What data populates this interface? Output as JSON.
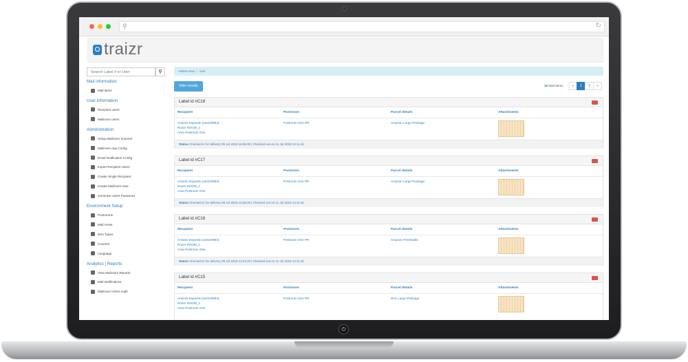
{
  "browser": {
    "url": ""
  },
  "app": {
    "logo_text": "traizr"
  },
  "search": {
    "placeholder": "Search Label # or User"
  },
  "sidebar": {
    "sections": [
      {
        "title": "Mail information",
        "items": [
          {
            "label": "Mail items",
            "icon": "home-icon"
          }
        ]
      },
      {
        "title": "User information",
        "items": [
          {
            "label": "Recipient users",
            "icon": "users-icon"
          },
          {
            "label": "Mailroom users",
            "icon": "user-icon"
          }
        ]
      },
      {
        "title": "Administration",
        "items": [
          {
            "label": "Setup Mailroom Scanner",
            "icon": "wrench-icon"
          },
          {
            "label": "Mailroom App Config",
            "icon": "phone-icon"
          },
          {
            "label": "Email Notification Config",
            "icon": "envelope-icon"
          },
          {
            "label": "Import Recipient Users",
            "icon": "import-icon"
          },
          {
            "label": "Create Single Recipient",
            "icon": "user-icon"
          },
          {
            "label": "Create Mailroom User",
            "icon": "user-icon"
          },
          {
            "label": "Generate Users Password",
            "icon": "lock-icon"
          }
        ]
      },
      {
        "title": "Environment Setup",
        "items": [
          {
            "label": "Postrooms",
            "icon": "building-icon"
          },
          {
            "label": "Mail Areas",
            "icon": "map-icon"
          },
          {
            "label": "Item Types",
            "icon": "list-icon"
          },
          {
            "label": "Couriers",
            "icon": "truck-icon"
          },
          {
            "label": "Language",
            "icon": "globe-icon"
          }
        ]
      },
      {
        "title": "Analytics | Reports",
        "items": [
          {
            "label": "View Mailroom Reports",
            "icon": "report-icon"
          },
          {
            "label": "Mail Notifications",
            "icon": "chat-icon"
          },
          {
            "label": "Mailroom Users Audit",
            "icon": "user-icon"
          }
        ]
      }
    ]
  },
  "breadcrumb": {
    "first": "Admin Area",
    "second": "Mail"
  },
  "toolbar": {
    "filter_label": "Filter results"
  },
  "pagination": {
    "total_count": "16",
    "total_suffix": "total items",
    "prev": "«",
    "pages": [
      "1",
      "2"
    ],
    "next": "»"
  },
  "columns": {
    "recipient": "Recipient",
    "postroom": "Postroom",
    "parcel": "Parcel details",
    "attachments": "Attachments"
  },
  "status_label": "Status",
  "cards": [
    {
      "title": "Label id #C18",
      "recipient_name": "Antonio Esposito (ant100984)",
      "room": "Room ROOM_1",
      "area": "Area Postroom One",
      "postroom": "Postroom One PR",
      "parcel": "Amazon Large Package",
      "status": "Checked in for delivery 09 Jul 2019 15:06:39 | Checked out on 11 Jul 2019 14:11:42"
    },
    {
      "title": "Label id #C17",
      "recipient_name": "Antonio Esposito (ant100984)",
      "room": "Room ROOM_1",
      "area": "Area Postroom One",
      "postroom": "Postroom One PR",
      "parcel": "Amazon Large Package",
      "status": "Checked in for delivery 09 Jul 2019 13:36:28 | Checked out on 11 Jul 2019 14:11:42"
    },
    {
      "title": "Label id #C16",
      "recipient_name": "Antonio Esposito (ant100984)",
      "room": "Room ROOM_1",
      "area": "Area Postroom One",
      "postroom": "Postroom One PR",
      "parcel": "Amazon Perishable",
      "status": "Checked in for delivery 09 Jul 2019 13:34:33 | Checked out on 11 Jul 2019 14:11:42"
    },
    {
      "title": "Label id #C15",
      "recipient_name": "Antonio Esposito (ant100984)",
      "room": "Room ROOM_1",
      "area": "Area Postroom One",
      "postroom": "Postroom One PR",
      "parcel": "DHL Large Package",
      "status": ""
    }
  ]
}
